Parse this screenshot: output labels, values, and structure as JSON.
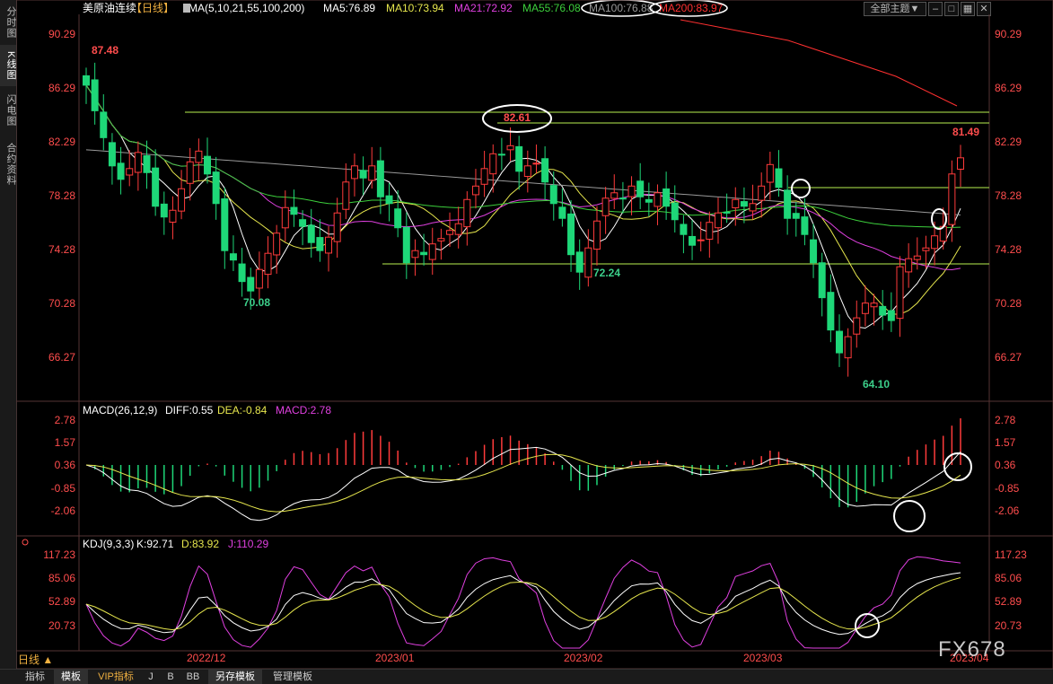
{
  "side_tabs": [
    {
      "label": "分时图",
      "active": false
    },
    {
      "label": "K线图",
      "active": true
    },
    {
      "label": "闪电图",
      "active": false
    },
    {
      "label": "合约资料",
      "active": false
    }
  ],
  "header": {
    "symbol": "美原油连续",
    "period": "【日线】",
    "ma_label": "MA(5,10,21,55,100,200)",
    "ma5": "MA5:76.89",
    "ma10": "MA10:73.94",
    "ma21": "MA21:72.92",
    "ma55": "MA55:76.08",
    "ma100": "MA100:76.88",
    "ma200": "MA200:83.97",
    "theme_select": "全部主题▼"
  },
  "colors": {
    "up": "#ff3b3b",
    "down": "#1ed778",
    "ma5": "#ffffff",
    "ma10": "#e6e64d",
    "ma21": "#e040e0",
    "ma55": "#3ccf3c",
    "ma100": "#999999",
    "ma200": "#ff3030",
    "axis_text": "#ff4d4d"
  },
  "chart_data": {
    "type": "candlestick",
    "price_axis": {
      "ticks": [
        "90.29",
        "86.29",
        "82.29",
        "78.28",
        "74.28",
        "70.28",
        "66.27"
      ],
      "ylim": [
        63.0,
        91.5
      ]
    },
    "date_ticks": [
      "2022/12",
      "2023/01",
      "2023/02",
      "2023/03",
      "2023/04"
    ],
    "annotations": [
      "87.48",
      "82.61",
      "81.49",
      "72.24",
      "70.08",
      "64.10"
    ],
    "horizontal_lines": [
      83.3,
      82.4,
      78.0,
      73.0,
      72.4
    ],
    "candles_close_estimate": [
      86.5,
      84.6,
      82.6,
      80.5,
      79.5,
      80.3,
      81.5,
      80.0,
      77.5,
      76.7,
      77.2,
      78.8,
      80.8,
      81.6,
      79.9,
      77.7,
      74.2,
      73.5,
      71.9,
      71.2,
      72.8,
      74.0,
      75.5,
      77.4,
      76.9,
      76.0,
      74.8,
      74.2,
      75.2,
      77.0,
      79.3,
      80.5,
      79.6,
      80.5,
      78.2,
      77.7,
      75.9,
      73.3,
      74.2,
      73.9,
      74.7,
      75.1,
      75.7,
      76.2,
      78.0,
      79.0,
      80.3,
      81.4,
      81.3,
      82.0,
      80.1,
      80.5,
      80.7,
      79.3,
      77.7,
      76.6,
      73.9,
      72.6,
      74.4,
      76.4,
      78.1,
      78.5,
      78.1,
      79.0,
      78.2,
      77.8,
      78.5,
      77.5,
      76.5,
      75.4,
      74.6,
      75.0,
      76.3,
      77.0,
      77.0,
      78.0,
      77.5,
      77.7,
      79.0,
      80.6,
      78.9,
      76.6,
      76.6,
      75.4,
      73.3,
      70.7,
      68.3,
      66.6,
      67.8,
      69.2,
      70.3,
      70.3,
      69.4,
      69.0,
      73.0,
      73.6,
      73.8,
      74.4,
      75.3,
      76.0,
      79.9,
      81.1
    ],
    "macd": {
      "ticks": [
        "2.78",
        "1.57",
        "0.36",
        "-0.85",
        "-2.06"
      ],
      "label": "MACD(26,12,9)",
      "diff": "DIFF:0.55",
      "dea": "DEA:-0.84",
      "macd": "MACD:2.78"
    },
    "kdj": {
      "ticks": [
        "117.23",
        "85.06",
        "52.89",
        "20.73"
      ],
      "label": "KDJ(9,3,3)",
      "k": "K:92.71",
      "d": "D:83.92",
      "j": "J:110.29"
    }
  },
  "period_label": "日线 ▲",
  "bottom_tabs": [
    {
      "label": "指标",
      "active": false
    },
    {
      "label": "模板",
      "active": true
    },
    {
      "label": "VIP指标",
      "active": false,
      "accent": true
    },
    {
      "label": "J",
      "active": false
    },
    {
      "label": "B",
      "active": false
    },
    {
      "label": "BB",
      "active": false
    },
    {
      "label": "另存模板",
      "active": true
    },
    {
      "label": "管理模板",
      "active": false
    }
  ],
  "watermark": "FX678"
}
